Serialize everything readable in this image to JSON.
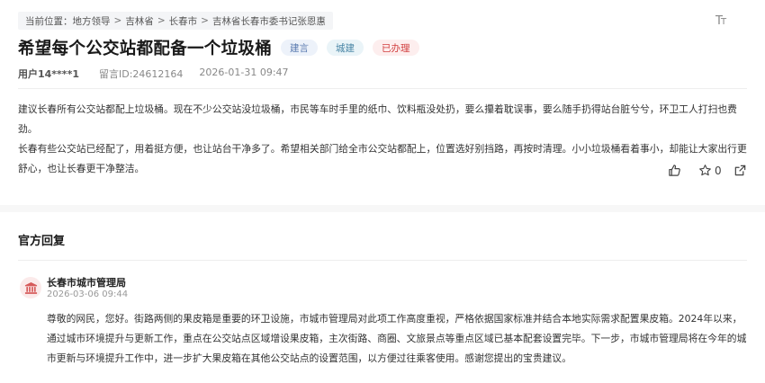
{
  "breadcrumb": {
    "prefix": "当前位置：",
    "items": [
      "地方领导",
      "吉林省",
      "长春市",
      "吉林省长春市委书记张恩惠"
    ],
    "separator": ">"
  },
  "font_toggle": {
    "large": "T",
    "small": "T"
  },
  "message": {
    "title": "希望每个公交站都配备一个垃圾桶",
    "tags": [
      {
        "label": "建言",
        "color": "#5a7bb0"
      },
      {
        "label": "城建",
        "color": "#4a86a6"
      },
      {
        "label": "已办理",
        "color": "#d13d3d"
      }
    ],
    "user": "用户14****1",
    "message_id": "留言ID:24612164",
    "datetime": "2026-01-31 09:47",
    "paragraphs": [
      "建议长春所有公交站都配上垃圾桶。现在不少公交站没垃圾桶，市民等车时手里的纸巾、饮料瓶没处扔，要么攥着耽误事，要么随手扔得站台脏兮兮，环卫工人打扫也费劲。",
      "长春有些公交站已经配了，用着挺方便，也让站台干净多了。希望相关部门给全市公交站都配上，位置选好别挡路，再按时清理。小小垃圾桶看着事小，却能让大家出行更舒心，也让长春更干净整洁。"
    ],
    "favorite_count": "0"
  },
  "reply": {
    "heading": "官方回复",
    "org_name": "长春市城市管理局",
    "datetime": "2026-03-06 09:44",
    "text": "尊敬的网民，您好。街路两侧的果皮箱是重要的环卫设施，市城市管理局对此项工作高度重视，严格依据国家标准并结合本地实际需求配置果皮箱。2024年以来，通过城市环境提升与更新工作，重点在公交站点区域增设果皮箱，主次街路、商圈、文旅景点等重点区域已基本配套设置完毕。下一步，市城市管理局将在今年的城市更新与环境提升工作中，进一步扩大果皮箱在其他公交站点的设置范围，以方便过往乘客使用。感谢您提出的宝贵建议。"
  },
  "icons": {
    "like": "thumbs-up-icon",
    "favorite": "star-icon",
    "share": "share-icon",
    "org": "government-building-icon"
  }
}
